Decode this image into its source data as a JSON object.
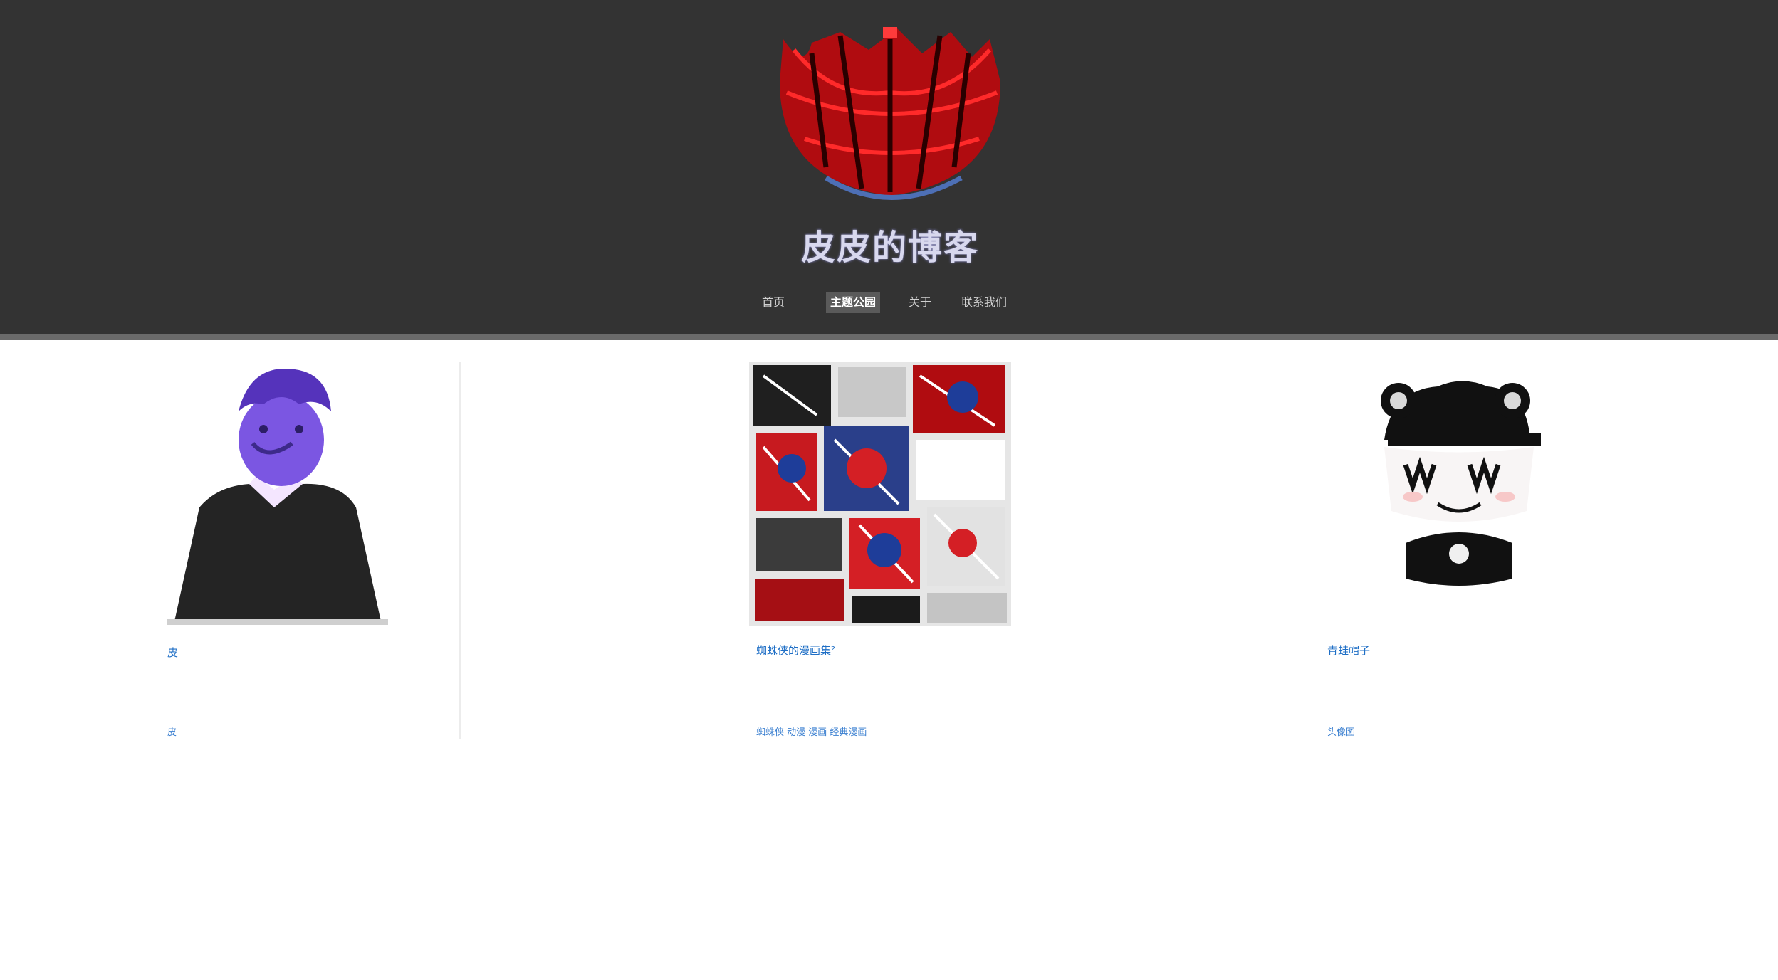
{
  "header": {
    "site_title": "皮皮的博客",
    "nav": [
      {
        "label": "首页",
        "active": false
      },
      {
        "label": "主题公园",
        "active": true
      },
      {
        "label": "关于",
        "active": false
      },
      {
        "label": "联系我们",
        "active": false
      }
    ]
  },
  "cards": [
    {
      "link": "皮",
      "meta": "皮"
    },
    {
      "link": "蜘蛛侠的漫画集²",
      "meta": "蜘蛛侠 动漫 漫画 经典漫画"
    },
    {
      "link": "青蛙帽子",
      "meta": "头像图"
    }
  ],
  "colors": {
    "header_bg": "#333333",
    "logo_red": "#d40f14",
    "avatar_purple": "#8a63e8",
    "link_blue": "#1f6fc6"
  },
  "icons": {
    "logo": "spider-logo-icon",
    "card_1": "person-avatar-image",
    "card_2": "spiderman-comic-collage-image",
    "card_3": "frog-hat-avatar-image"
  }
}
